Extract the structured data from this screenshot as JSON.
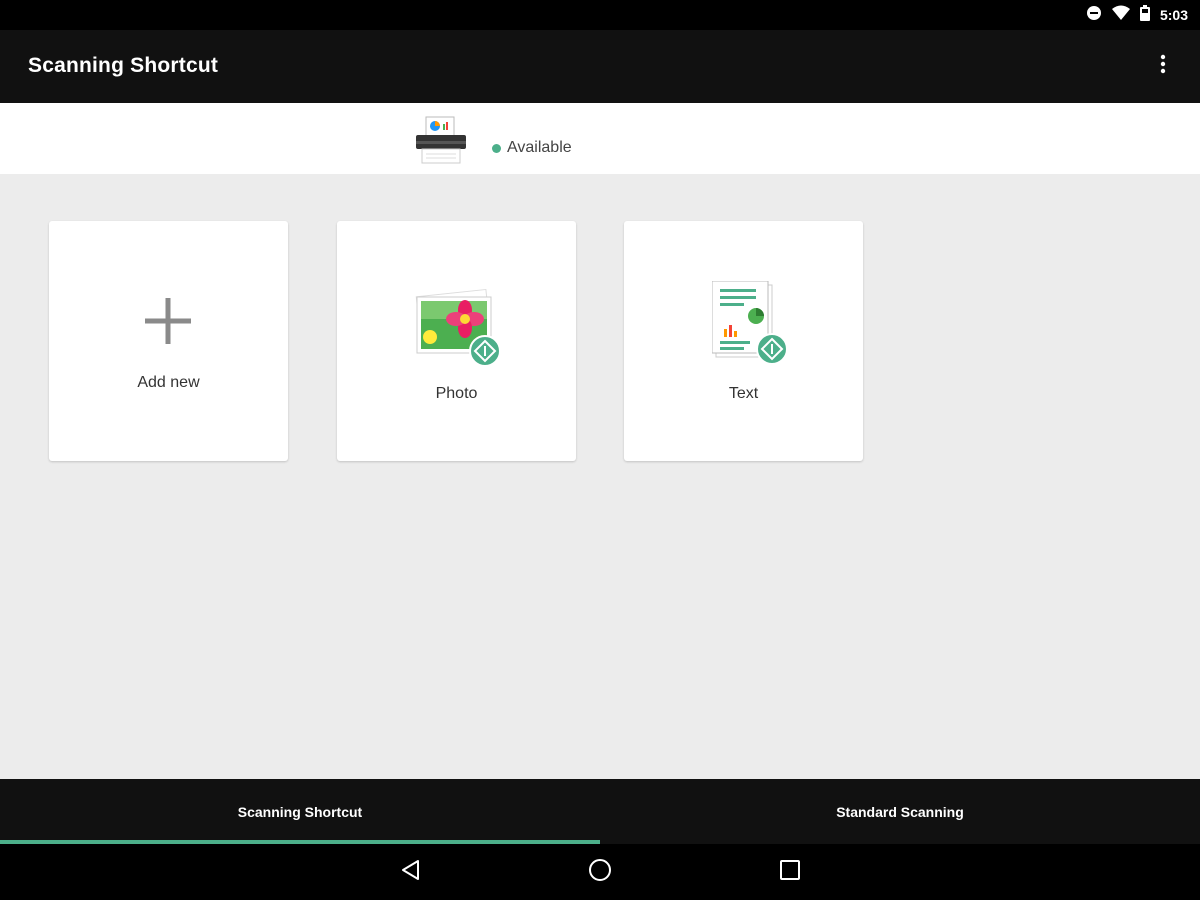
{
  "status_bar": {
    "time": "5:03",
    "icons": [
      "do-not-disturb-icon",
      "wifi-icon",
      "battery-icon"
    ]
  },
  "app_bar": {
    "title": "Scanning Shortcut",
    "overflow_icon": "more-vertical-icon"
  },
  "device": {
    "icon": "scanner-icon",
    "status": "Available",
    "status_color": "#4caf8a"
  },
  "shortcuts": [
    {
      "label": "Add new",
      "icon": "plus-icon"
    },
    {
      "label": "Photo",
      "icon": "photo-icon"
    },
    {
      "label": "Text",
      "icon": "document-icon"
    }
  ],
  "tabs": [
    {
      "label": "Scanning Shortcut",
      "selected": true
    },
    {
      "label": "Standard Scanning",
      "selected": false
    }
  ],
  "nav": [
    "back-icon",
    "home-icon",
    "recents-icon"
  ],
  "colors": {
    "accent": "#4caf8a",
    "app_bar": "#111111",
    "background": "#ececec"
  }
}
